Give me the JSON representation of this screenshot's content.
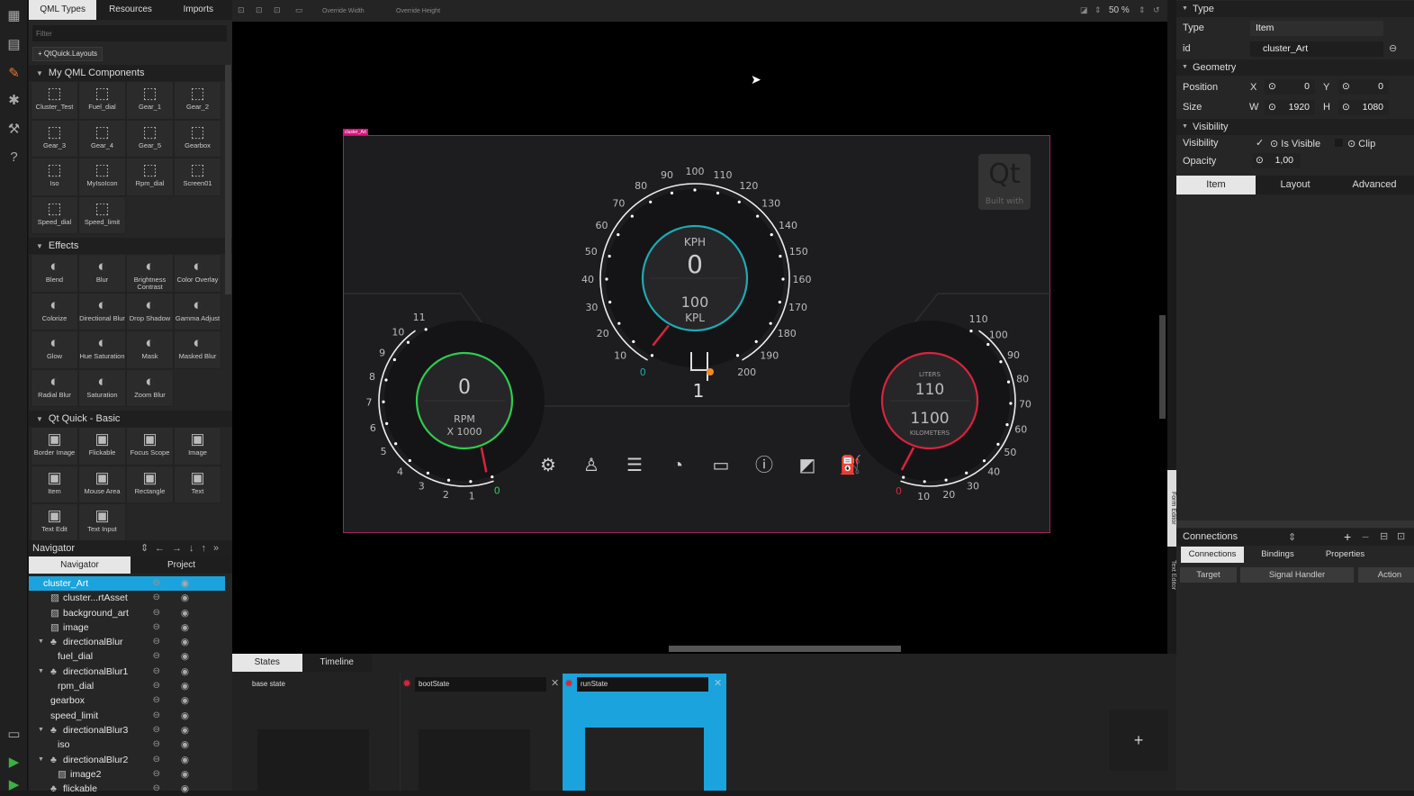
{
  "colors": {
    "accent": "#1aa3dc",
    "speed": "#1fa9b4",
    "rpm": "#2fcc4e",
    "fuel": "#d8243c",
    "selection": "#d6167d"
  },
  "library": {
    "tabs": [
      "QML Types",
      "Resources",
      "Imports"
    ],
    "filter_placeholder": "Filter",
    "add_import": "QtQuick.Layouts",
    "sections": [
      {
        "title": "My QML Components",
        "icon": "chip-icon",
        "items": [
          "Cluster_Test",
          "Fuel_dial",
          "Gear_1",
          "Gear_2",
          "Gear_3",
          "Gear_4",
          "Gear_5",
          "Gearbox",
          "Iso",
          "MyIsoIcon",
          "Rpm_dial",
          "Screen01",
          "Speed_dial",
          "Speed_limit"
        ]
      },
      {
        "title": "Effects",
        "icon": "effect-icon",
        "items": [
          "Blend",
          "Blur",
          "Brightness Contrast",
          "Color Overlay",
          "Colorize",
          "Directional Blur",
          "Drop Shadow",
          "Gamma Adjust",
          "Glow",
          "Hue Saturation",
          "Mask",
          "Masked Blur",
          "Radial Blur",
          "Saturation",
          "Zoom Blur"
        ]
      },
      {
        "title": "Qt Quick - Basic",
        "icon": "item-icon",
        "items": [
          "Border Image",
          "Flickable",
          "Focus Scope",
          "Image",
          "Item",
          "Mouse Area",
          "Rectangle",
          "Text",
          "Text Edit",
          "Text Input"
        ]
      }
    ]
  },
  "navigator": {
    "title": "Navigator",
    "tabs": [
      "Navigator",
      "Project"
    ],
    "tree": [
      {
        "name": "cluster_Art",
        "depth": 0,
        "selected": true
      },
      {
        "name": "cluster...rtAsset",
        "depth": 1,
        "icon": "image"
      },
      {
        "name": "background_art",
        "depth": 1,
        "icon": "image"
      },
      {
        "name": "image",
        "depth": 1,
        "icon": "image"
      },
      {
        "name": "directionalBlur",
        "depth": 1,
        "icon": "effect",
        "expanded": true
      },
      {
        "name": "fuel_dial",
        "depth": 2
      },
      {
        "name": "directionalBlur1",
        "depth": 1,
        "icon": "effect",
        "expanded": true
      },
      {
        "name": "rpm_dial",
        "depth": 2
      },
      {
        "name": "gearbox",
        "depth": 1
      },
      {
        "name": "speed_limit",
        "depth": 1
      },
      {
        "name": "directionalBlur3",
        "depth": 1,
        "icon": "effect",
        "expanded": true
      },
      {
        "name": "iso",
        "depth": 2
      },
      {
        "name": "directionalBlur2",
        "depth": 1,
        "icon": "effect",
        "expanded": true
      },
      {
        "name": "image2",
        "depth": 2,
        "icon": "image"
      },
      {
        "name": "flickable",
        "depth": 1,
        "icon": "effect"
      }
    ]
  },
  "canvas": {
    "override_width": "Override Width",
    "override_height": "Override Height",
    "zoom": "50 %",
    "item_label": "cluster_Art",
    "watermark": {
      "logo": "Qt",
      "text": "Built with"
    },
    "speed": {
      "unit": "KPH",
      "value": "0",
      "sub_value": "100",
      "sub_unit": "KPL",
      "ticks": [
        "0",
        "10",
        "20",
        "30",
        "40",
        "50",
        "60",
        "70",
        "80",
        "90",
        "100",
        "110",
        "120",
        "130",
        "140",
        "150",
        "160",
        "170",
        "180",
        "190",
        "200"
      ]
    },
    "gear": {
      "value": "1"
    },
    "rpm": {
      "value": "0",
      "unit": "RPM",
      "multiplier": "X 1000",
      "ticks": [
        "0",
        "1",
        "2",
        "3",
        "4",
        "5",
        "6",
        "7",
        "8",
        "9",
        "10",
        "11"
      ]
    },
    "fuel": {
      "top_label": "LITERS",
      "value": "110",
      "sub_value": "1100",
      "sub_label": "KILOMETERS",
      "ticks": [
        "0",
        "10",
        "20",
        "30",
        "40",
        "50",
        "60",
        "70",
        "80",
        "90",
        "100",
        "110"
      ]
    },
    "telltales": [
      "engine-check-icon",
      "seatbelt-icon",
      "headlight-icon",
      "speed-limiter-icon",
      "battery-icon",
      "tire-pressure-icon",
      "door-open-icon",
      "fuel-icon"
    ]
  },
  "side_strip": {
    "form_editor": "Form Editor",
    "text_editor": "Text Editor"
  },
  "states": {
    "tabs": [
      "States",
      "Timeline"
    ],
    "items": [
      {
        "name": "base state"
      },
      {
        "name": "bootState"
      },
      {
        "name": "runState",
        "selected": true
      }
    ],
    "add": "+"
  },
  "properties": {
    "type_section": "Type",
    "type_label": "Type",
    "type_value": "Item",
    "id_label": "id",
    "id_value": "cluster_Art",
    "geometry_section": "Geometry",
    "position_label": "Position",
    "x_label": "X",
    "x": "0",
    "y_label": "Y",
    "y": "0",
    "size_label": "Size",
    "w_label": "W",
    "w": "1920",
    "h_label": "H",
    "h": "1080",
    "visibility_section": "Visibility",
    "visibility_label": "Visibility",
    "is_visible_label": "Is Visible",
    "is_visible": true,
    "clip_label": "Clip",
    "clip": false,
    "opacity_label": "Opacity",
    "opacity": "1,00",
    "tabs": [
      "Item",
      "Layout",
      "Advanced"
    ]
  },
  "connections": {
    "title": "Connections",
    "tabs": [
      "Connections",
      "Bindings",
      "Properties"
    ],
    "columns": [
      "Target",
      "Signal Handler",
      "Action"
    ]
  }
}
